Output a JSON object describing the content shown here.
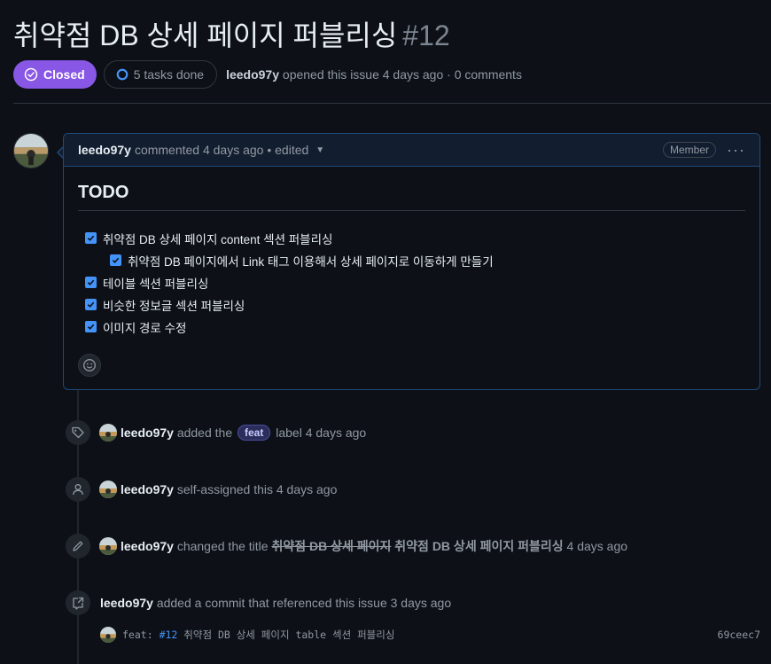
{
  "issue": {
    "title": "취약점 DB 상세 페이지 퍼블리싱",
    "number": "#12",
    "state": "Closed",
    "tasks": "5 tasks done",
    "author": "leedo97y",
    "opened_text": "opened this issue 4 days ago · 0 comments"
  },
  "comment": {
    "author": "leedo97y",
    "meta": "commented 4 days ago • edited",
    "role": "Member",
    "heading": "TODO",
    "tasks": [
      {
        "text": "취약점 DB 상세 페이지 content 섹션 퍼블리싱",
        "checked": true
      },
      {
        "text": "취약점 DB 페이지에서 Link 태그 이용해서 상세 페이지로 이동하게 만들기",
        "checked": true,
        "sub": true
      },
      {
        "text": "테이블 섹션 퍼블리싱",
        "checked": true
      },
      {
        "text": "비슷한 정보글 섹션 퍼블리싱",
        "checked": true
      },
      {
        "text": "이미지 경로 수정",
        "checked": true
      }
    ]
  },
  "timeline": {
    "label_event": {
      "author": "leedo97y",
      "pre": "added the",
      "label": "feat",
      "post": "label 4 days ago"
    },
    "assign_event": {
      "author": "leedo97y",
      "text": "self-assigned this 4 days ago"
    },
    "rename_event": {
      "author": "leedo97y",
      "pre": "changed the title",
      "old_title": "취약점 DB 상세 페이지",
      "new_title": "취약점 DB 상세 페이지 퍼블리싱",
      "post": "4 days ago"
    },
    "commit_event": {
      "author": "leedo97y",
      "text": "added a commit that referenced this issue 3 days ago"
    },
    "commit": {
      "prefix": "feat:",
      "ref": "#12",
      "message": "취약점 DB 상세 페이지 table 섹션 퍼블리싱",
      "sha": "69ceec7"
    }
  },
  "colors": {
    "background": "#0d1117",
    "closed": "#8957e5",
    "accent": "#4493f8",
    "label_feat": "#2b2d5a"
  },
  "icons": [
    "issue-closed-icon",
    "progress-icon",
    "kebab-icon",
    "smiley-icon",
    "tag-icon",
    "person-icon",
    "pencil-icon",
    "cross-reference-icon"
  ]
}
